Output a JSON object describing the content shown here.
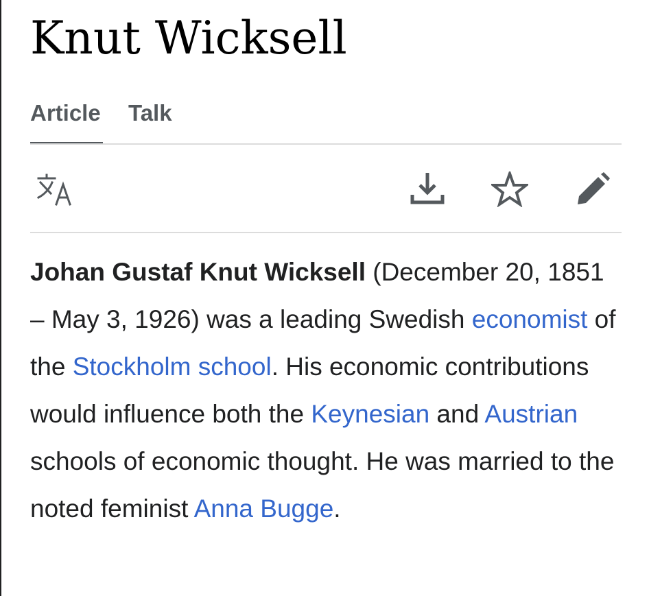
{
  "page": {
    "title": "Knut Wicksell"
  },
  "tabs": [
    {
      "label": "Article",
      "active": true
    },
    {
      "label": "Talk",
      "active": false
    }
  ],
  "toolbar": {
    "icons": [
      "language-icon",
      "download-icon",
      "star-icon",
      "edit-icon"
    ]
  },
  "lead": {
    "subject": "Johan Gustaf Knut Wicksell",
    "text_1": " (December 20, 1851 – May 3, 1926) was a leading Swedish ",
    "link_1": "economist",
    "text_2": " of the ",
    "link_2": "Stockholm school",
    "text_3": ". His economic contributions would influence both the ",
    "link_3": "Keynesian",
    "text_4": " and ",
    "link_4": "Austrian",
    "text_5": " schools of economic thought. He was married to the noted feminist ",
    "link_5": "Anna Bugge",
    "text_6": "."
  },
  "colors": {
    "link": "#3366cc",
    "text": "#202122",
    "tab": "#54595d",
    "divider": "#dcdcdc"
  }
}
